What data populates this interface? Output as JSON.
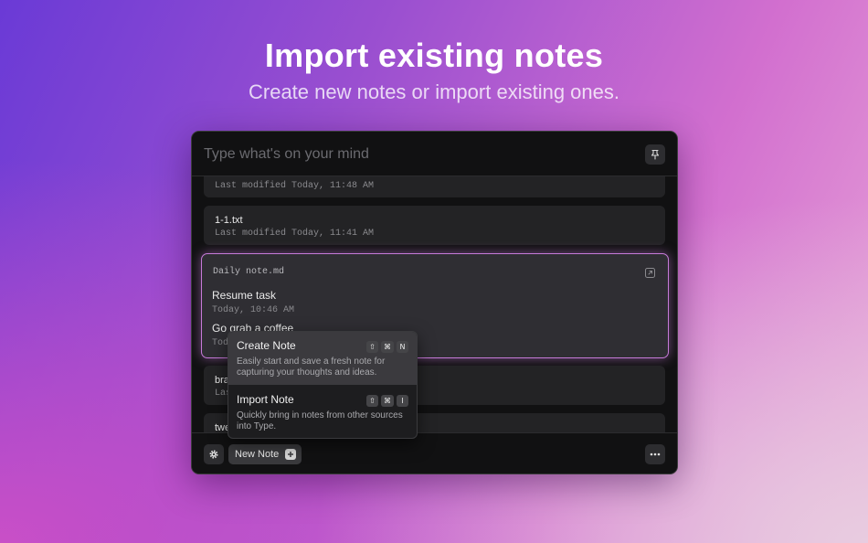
{
  "hero": {
    "title": "Import existing notes",
    "subtitle": "Create new notes or import existing ones."
  },
  "search": {
    "placeholder": "Type what's on your mind"
  },
  "icons": {
    "pin": "pin-icon",
    "settings": "gear-icon",
    "more": "ellipsis-icon",
    "open": "open-external-icon",
    "plus": "plus-icon"
  },
  "notes": [
    {
      "title": "",
      "modified": "Last modified Today, 11:48 AM"
    },
    {
      "title": "1-1.txt",
      "modified": "Last modified Today, 11:41 AM"
    }
  ],
  "selected_note": {
    "filename": "Daily note.md",
    "tasks": [
      {
        "title": "Resume task",
        "time": "Today, 10:46 AM"
      },
      {
        "title": "Go grab a coffee",
        "time": "Toda"
      }
    ]
  },
  "partial_notes": [
    {
      "title": "bra",
      "modified": "Las"
    },
    {
      "title": "twe",
      "modified": ""
    }
  ],
  "footer": {
    "new_note_label": "New Note"
  },
  "menu": {
    "items": [
      {
        "title": "Create Note",
        "description": "Easily start and save a fresh note for capturing your thoughts and ideas.",
        "keys": [
          "⇧",
          "⌘",
          "N"
        ]
      },
      {
        "title": "Import Note",
        "description": "Quickly bring in notes from other sources into Type.",
        "keys": [
          "⇧",
          "⌘",
          "I"
        ]
      }
    ]
  },
  "colors": {
    "accent": "#c67ad8",
    "window_bg": "#111112",
    "card_bg": "#232325"
  }
}
